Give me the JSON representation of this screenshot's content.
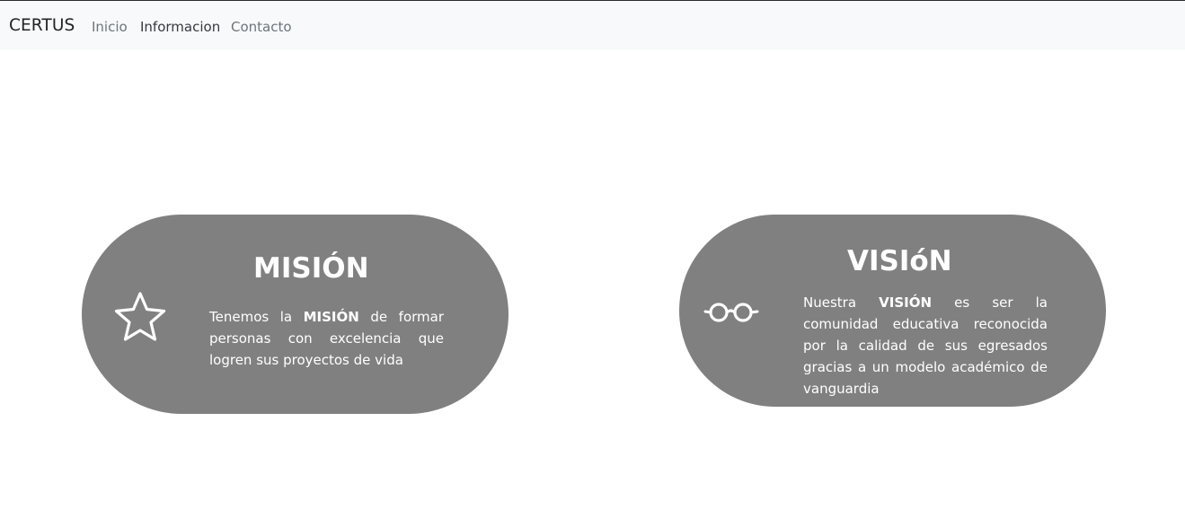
{
  "nav": {
    "brand": "CERTUS",
    "links": [
      {
        "label": "Inicio"
      },
      {
        "label": "Informacion"
      },
      {
        "label": "Contacto"
      }
    ]
  },
  "mision": {
    "title": "MISIÓN",
    "icon": "star-icon",
    "text_before": "Tenemos la ",
    "text_bold": "MISIÓN",
    "text_after": " de formar personas con excelencia que logren sus proyectos de vida"
  },
  "vision": {
    "title": "VISIóN",
    "icon": "glasses-icon",
    "text_before": "Nuestra ",
    "text_bold": "VISIÓN",
    "text_after": " es ser la comunidad educativa reconocida por la calidad de sus egresados gracias a un modelo académico de vanguardia"
  },
  "colors": {
    "navbar_bg": "#f8f9fa",
    "card_bg": "#808080",
    "card_text": "#ffffff"
  }
}
